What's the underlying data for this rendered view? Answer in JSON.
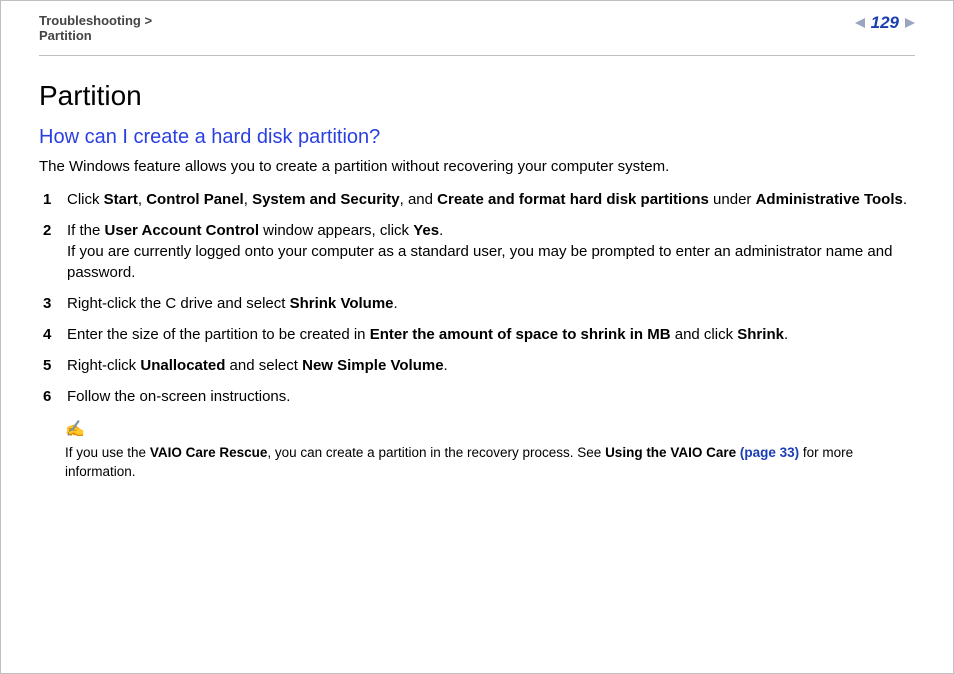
{
  "header": {
    "breadcrumb1": "Troubleshooting",
    "gt": ">",
    "breadcrumb2": "Partition",
    "pageNumber": "129"
  },
  "title": "Partition",
  "subtitle": "How can I create a hard disk partition?",
  "intro": "The Windows feature allows you to create a partition without recovering your computer system.",
  "steps": [
    {
      "num": "1",
      "parts": [
        {
          "t": "Click "
        },
        {
          "t": "Start",
          "b": true
        },
        {
          "t": ", "
        },
        {
          "t": "Control Panel",
          "b": true
        },
        {
          "t": ", "
        },
        {
          "t": "System and Security",
          "b": true
        },
        {
          "t": ", and "
        },
        {
          "t": "Create and format hard disk partitions",
          "b": true
        },
        {
          "t": " under "
        },
        {
          "t": "Administrative Tools",
          "b": true
        },
        {
          "t": "."
        }
      ]
    },
    {
      "num": "2",
      "parts": [
        {
          "t": "If the "
        },
        {
          "t": "User Account Control",
          "b": true
        },
        {
          "t": " window appears, click "
        },
        {
          "t": "Yes",
          "b": true
        },
        {
          "t": "."
        },
        {
          "br": true
        },
        {
          "t": "If you are currently logged onto your computer as a standard user, you may be prompted to enter an administrator name and password."
        }
      ]
    },
    {
      "num": "3",
      "parts": [
        {
          "t": "Right-click the C drive and select "
        },
        {
          "t": "Shrink Volume",
          "b": true
        },
        {
          "t": "."
        }
      ]
    },
    {
      "num": "4",
      "parts": [
        {
          "t": "Enter the size of the partition to be created in "
        },
        {
          "t": "Enter the amount of space to shrink in MB",
          "b": true
        },
        {
          "t": " and click "
        },
        {
          "t": "Shrink",
          "b": true
        },
        {
          "t": "."
        }
      ]
    },
    {
      "num": "5",
      "parts": [
        {
          "t": "Right-click "
        },
        {
          "t": "Unallocated",
          "b": true
        },
        {
          "t": " and select "
        },
        {
          "t": "New Simple Volume",
          "b": true
        },
        {
          "t": "."
        }
      ]
    },
    {
      "num": "6",
      "parts": [
        {
          "t": "Follow the on-screen instructions."
        }
      ]
    }
  ],
  "noteIcon": "✍",
  "note": {
    "parts": [
      {
        "t": "If you use the "
      },
      {
        "t": "VAIO Care Rescue",
        "b": true
      },
      {
        "t": ", you can create a partition in the recovery process. See "
      },
      {
        "t": "Using the VAIO Care ",
        "b": true
      },
      {
        "t": "(page 33)",
        "link": true,
        "b": true
      },
      {
        "t": " for more information."
      }
    ]
  }
}
